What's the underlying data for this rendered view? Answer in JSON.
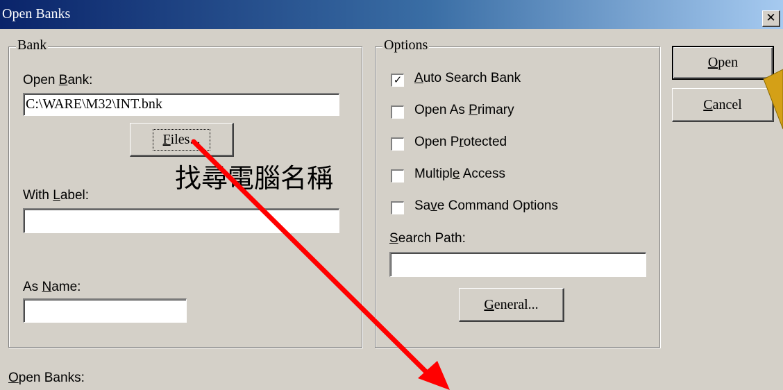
{
  "window": {
    "title": "Open Banks",
    "close_glyph": "✕"
  },
  "bank": {
    "legend": "Bank",
    "open_bank": {
      "pre": "Open ",
      "key": "B",
      "post": "ank:",
      "value": "C:\\WARE\\M32\\INT.bnk"
    },
    "files_button": {
      "key": "F",
      "post": "iles..."
    },
    "with_label": {
      "pre": "With ",
      "key": "L",
      "post": "abel:",
      "value": ""
    },
    "as_name": {
      "pre": "As ",
      "key": "N",
      "post": "ame:",
      "value": ""
    }
  },
  "options": {
    "legend": "Options",
    "checkboxes": [
      {
        "pre": "",
        "key": "A",
        "post": "uto Search Bank",
        "checked": true
      },
      {
        "pre": "Open As ",
        "key": "P",
        "post": "rimary",
        "checked": false
      },
      {
        "pre": "Open P",
        "key": "r",
        "post": "otected",
        "checked": false
      },
      {
        "pre": "Multipl",
        "key": "e",
        "post": " Access",
        "checked": false
      },
      {
        "pre": "Sa",
        "key": "v",
        "post": "e Command Options",
        "checked": false
      }
    ],
    "search_path": {
      "key": "S",
      "post": "earch Path:",
      "value": ""
    },
    "general_button": {
      "key": "G",
      "post": "eneral..."
    }
  },
  "actions": {
    "open": {
      "key": "O",
      "post": "pen"
    },
    "cancel": {
      "key": "C",
      "post": "ancel"
    }
  },
  "open_banks_label": {
    "key": "O",
    "post": "pen Banks:"
  },
  "annotation": {
    "text": "找尋電腦名稱",
    "arrow_color": "#ff0000",
    "callout_color": "#d4a017"
  },
  "checkmark_glyph": "✓"
}
